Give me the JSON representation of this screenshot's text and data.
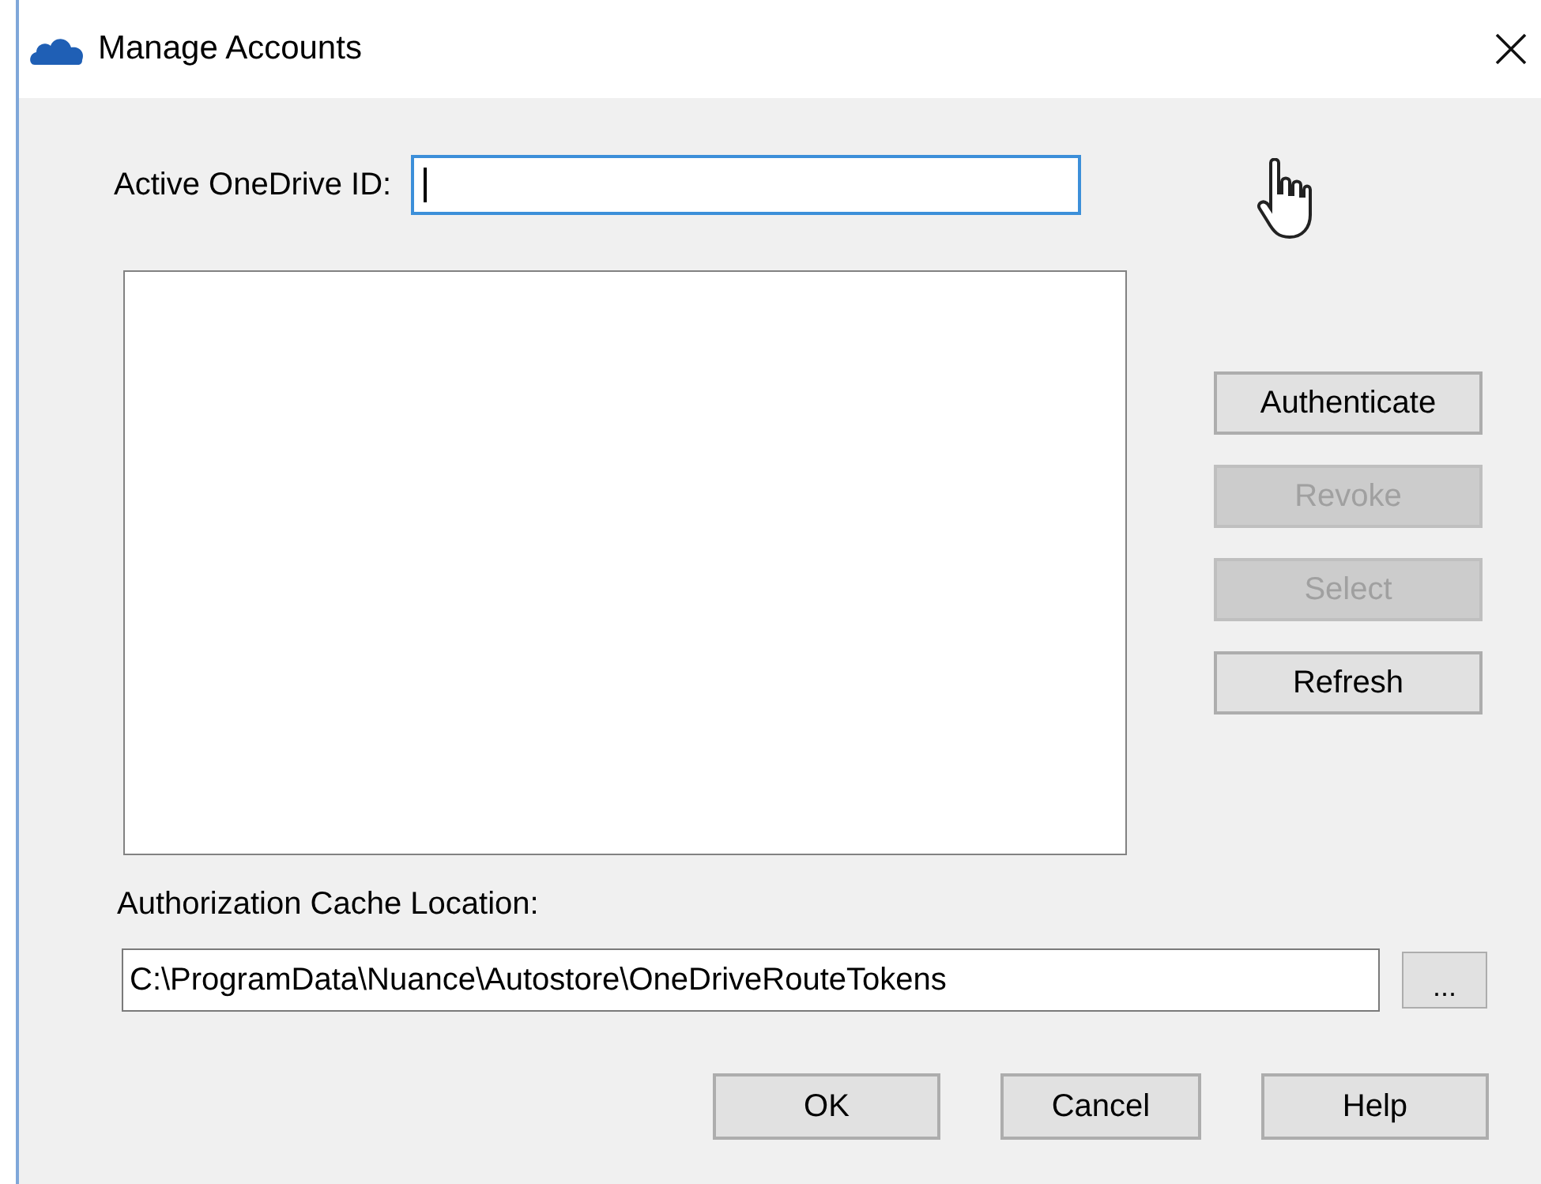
{
  "window": {
    "title": "Manage Accounts"
  },
  "active_id": {
    "label": "Active OneDrive ID:",
    "focused": true
  },
  "side_buttons": [
    {
      "label": "Authenticate",
      "disabled": false
    },
    {
      "label": "Revoke",
      "disabled": true
    },
    {
      "label": "Select",
      "disabled": true
    },
    {
      "label": "Refresh",
      "disabled": false
    }
  ],
  "cache_location": {
    "label": "Authorization Cache Location:",
    "value": "C:\\ProgramData\\Nuance\\Autostore\\OneDriveRouteTokens",
    "browse": "..."
  },
  "footer_buttons": [
    {
      "label": "OK"
    },
    {
      "label": "Cancel"
    },
    {
      "label": "Help"
    }
  ]
}
